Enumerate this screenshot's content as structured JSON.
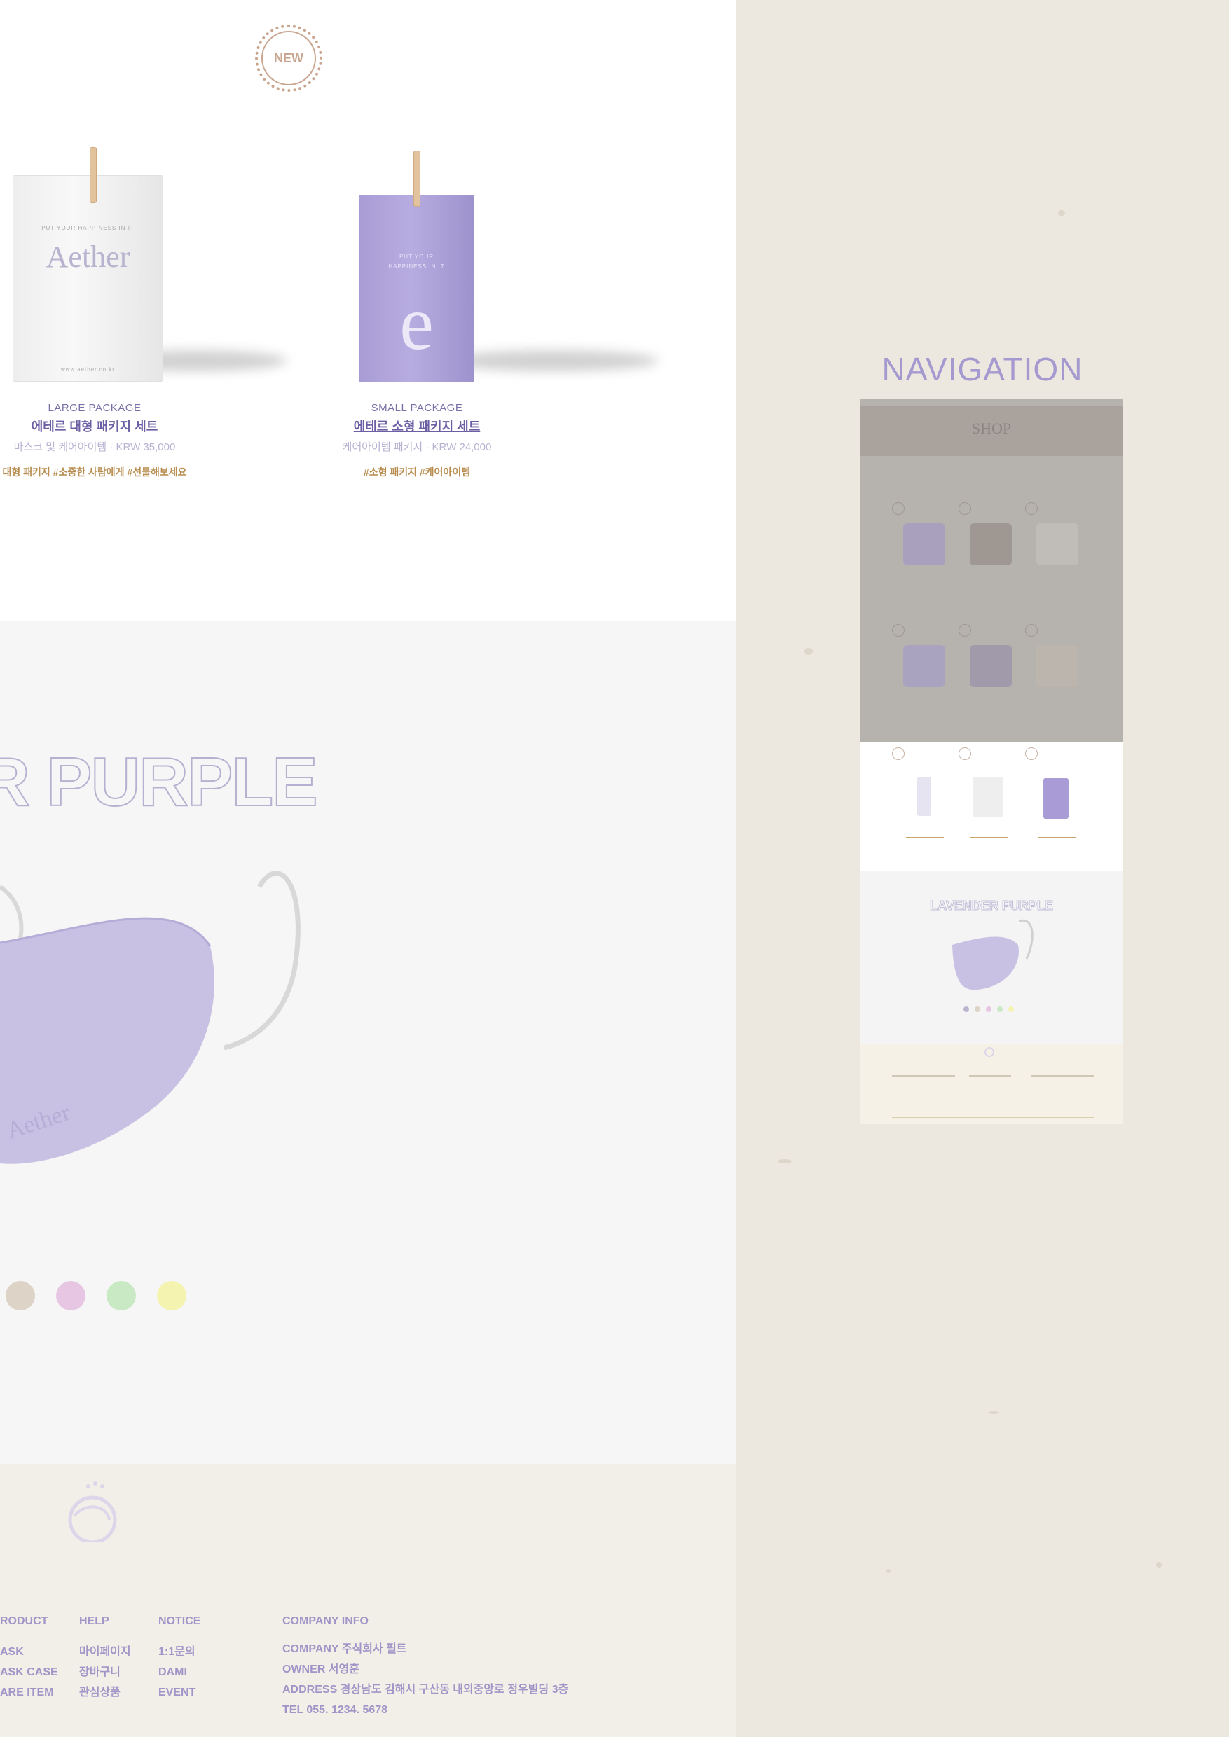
{
  "badge": {
    "label": "NEW"
  },
  "products": [
    {
      "bag_tagline": "PUT YOUR HAPPINESS IN IT",
      "bag_logo": "Aether",
      "bag_url": "www.aether.co.kr",
      "name_en": "LARGE PACKAGE",
      "name_ko": "에테르 대형 패키지 세트",
      "price": "마스크 및 케어아이템 · KRW 35,000",
      "tags": "대형 패키지 #소중한 사람에게 #선물해보세요"
    },
    {
      "bag_tagline": "PUT YOUR HAPPINESS IN IT",
      "bag_logo": "e",
      "name_en": "SMALL PACKAGE",
      "name_ko": "에테르 소형 패키지 세트",
      "price": "케어아이템 패키지 · KRW 24,000",
      "tags": "#소형 패키지 #케어아이템"
    }
  ],
  "lavender": {
    "title": "DER PURPLE",
    "mask_logo": "Aether",
    "colors": [
      "#ddd3c7",
      "#e7c6e3",
      "#c9e8c4",
      "#f5f3b0"
    ]
  },
  "footer": {
    "columns": [
      {
        "head": "RODUCT",
        "items": [
          "ASK",
          "ASK CASE",
          "ARE ITEM"
        ]
      },
      {
        "head": "HELP",
        "items": [
          "마이페이지",
          "장바구니",
          "관심상품"
        ]
      },
      {
        "head": "NOTICE",
        "items": [
          "1:1문의",
          "DAMI",
          "EVENT"
        ]
      }
    ],
    "company": {
      "head": "COMPANY INFO",
      "lines": [
        "COMPANY 주식회사 필트",
        "OWNER 서영훈",
        "ADDRESS 경상남도 김해시 구산동 내외중앙로 정우빌딩 3층",
        "TEL 055. 1234. 5678"
      ]
    }
  },
  "navigation": {
    "title": "NAVIGATION",
    "preview_shop_label": "SHOP",
    "preview_lavender_title": "LAVENDER PURPLE"
  }
}
